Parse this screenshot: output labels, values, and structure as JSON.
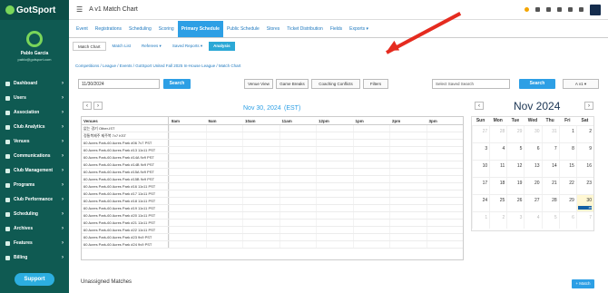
{
  "app": {
    "title": "A v1 Match Chart",
    "logo": "GotSport",
    "user": "Pablo Garcia",
    "email": "pablo@gotsport.com",
    "support": "Support"
  },
  "sidebar": [
    {
      "label": "Dashboard"
    },
    {
      "label": "Users"
    },
    {
      "label": "Association"
    },
    {
      "label": "Club Analytics"
    },
    {
      "label": "Venues"
    },
    {
      "label": "Communications"
    },
    {
      "label": "Club Management"
    },
    {
      "label": "Programs"
    },
    {
      "label": "Club Performance"
    },
    {
      "label": "Scheduling"
    },
    {
      "label": "Archives"
    },
    {
      "label": "Features"
    },
    {
      "label": "Billing"
    }
  ],
  "tabs": [
    "Event",
    "Registrations",
    "Scheduling",
    "Scoring",
    "Primary Schedule",
    "Public Schedule",
    "Stores",
    "Ticket Distribution",
    "Fields",
    "Exports ▾"
  ],
  "subtabs": {
    "matchchart": "Match Chart",
    "matchlist": "Match List",
    "referees": "Referees ▾",
    "saved": "Saved Reports ▾",
    "analysis": "Analysis"
  },
  "breadcrumb": "Competitions / League / Events / GotSport United Fall 2025 In-House League / Match Chart",
  "controls": {
    "date": "11/30/2024",
    "search": "Search",
    "venueview": "Venue View",
    "gamebreaks": "Game Breaks",
    "coaching": "Coaching Conflicts",
    "filters": "Filters",
    "savedsearch": "Select Saved Search",
    "search2": "Search",
    "division": "A v1 ▾"
  },
  "header": {
    "date": "Nov 30, 2024",
    "tz": "(EST)",
    "month": "Nov 2024"
  },
  "grid": {
    "venues": "Venues",
    "times": [
      "8am",
      "9am",
      "10am",
      "11am",
      "12pm",
      "1pm",
      "2pm",
      "3pm"
    ],
    "rows": [
      "없는 경기 Other-IST",
      "정통복제주 제주복 7v7 KST",
      "60 Acres Park-60 Acres Park #06 7v7 PST",
      "60 Acres Park-60 Acres Park #13 11v11 PST",
      "60 Acres Park-60 Acres Park #14A 9v9 PST",
      "60 Acres Park-60 Acres Park #14B 9v9 PST",
      "60 Acres Park-60 Acres Park #15A 9v9 PST",
      "60 Acres Park-60 Acres Park #15B 9v9 PST",
      "60 Acres Park-60 Acres Park #16 11v11 PST",
      "60 Acres Park-60 Acres Park #17 11v11 PST",
      "60 Acres Park-60 Acres Park #18 11v11 PST",
      "60 Acres Park-60 Acres Park #19 11v11 PST",
      "60 Acres Park-60 Acres Park #20 11v11 PST",
      "60 Acres Park-60 Acres Park #21 11v11 PST",
      "60 Acres Park-60 Acres Park #22 11v11 PST",
      "60 Acres Park-60 Acres Park #23 9v9 PST",
      "60 Acres Park-60 Acres Park #24 9v9 PST"
    ]
  },
  "calendar": {
    "days": [
      "Sun",
      "Mon",
      "Tue",
      "Wed",
      "Thu",
      "Fri",
      "Sat"
    ],
    "weeks": [
      [
        "27",
        "28",
        "29",
        "30",
        "31",
        "1",
        "2"
      ],
      [
        "3",
        "4",
        "5",
        "6",
        "7",
        "8",
        "9"
      ],
      [
        "10",
        "11",
        "12",
        "13",
        "14",
        "15",
        "16"
      ],
      [
        "17",
        "18",
        "19",
        "20",
        "21",
        "22",
        "23"
      ],
      [
        "24",
        "25",
        "26",
        "27",
        "28",
        "29",
        "30"
      ],
      [
        "1",
        "2",
        "3",
        "4",
        "5",
        "6",
        "7"
      ]
    ],
    "event": "48"
  },
  "footer": {
    "unassigned": "Unassigned Matches",
    "match": "+ Match"
  }
}
